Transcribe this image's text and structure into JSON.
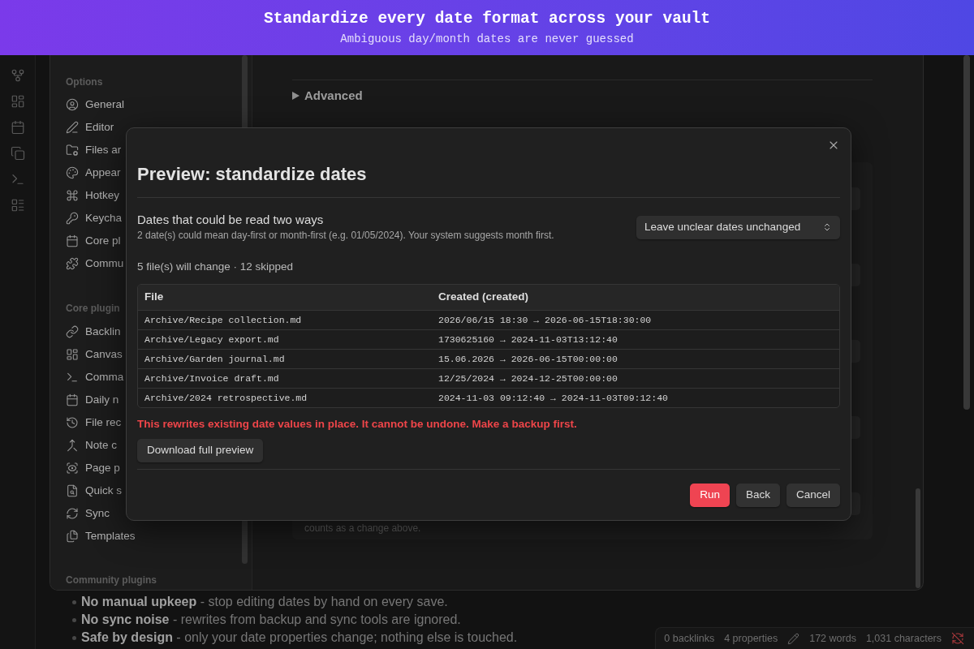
{
  "banner": {
    "title": "Standardize every date format across your vault",
    "subtitle": "Ambiguous day/month dates are never guessed"
  },
  "nav": {
    "options_heading": "Options",
    "options": [
      "General",
      "Editor",
      "Files ar",
      "Appear",
      "Hotkey",
      "Keycha",
      "Core pl",
      "Commu"
    ],
    "core_heading": "Core plugin",
    "core_plugins": [
      "Backlin",
      "Canvas",
      "Comma",
      "Daily n",
      "File rec",
      "Note c",
      "Page p",
      "Quick s",
      "Sync",
      "Templates"
    ],
    "community_heading": "Community plugins"
  },
  "panel": {
    "advanced": {
      "label": "Advanced",
      "expanded": false
    },
    "footnote": "counts as a change above."
  },
  "dialog": {
    "title": "Preview: standardize dates",
    "ambiguity": {
      "title": "Dates that could be read two ways",
      "description": "2 date(s) could mean day-first or month-first (e.g. 01/05/2024). Your system suggests month first.",
      "select": {
        "value": "Leave unclear dates unchanged"
      }
    },
    "summary": "5 file(s) will change · 12 skipped",
    "table": {
      "columns": [
        "File",
        "Created (created)"
      ],
      "rows": [
        [
          "Archive/Recipe collection.md",
          "2026/06/15 18:30 → 2026-06-15T18:30:00"
        ],
        [
          "Archive/Legacy export.md",
          "1730625160 → 2024-11-03T13:12:40"
        ],
        [
          "Archive/Garden journal.md",
          "15.06.2026 → 2026-06-15T00:00:00"
        ],
        [
          "Archive/Invoice draft.md",
          "12/25/2024 → 2024-12-25T00:00:00"
        ],
        [
          "Archive/2024 retrospective.md",
          "2024-11-03 09:12:40 → 2024-11-03T09:12:40"
        ]
      ]
    },
    "warning": "This rewrites existing date values in place. It cannot be undone. Make a backup first.",
    "download_button": "Download full preview",
    "buttons": [
      {
        "label": "Run",
        "kind": "primary"
      },
      {
        "label": "Back",
        "kind": "secondary"
      },
      {
        "label": "Cancel",
        "kind": "secondary"
      }
    ]
  },
  "note": {
    "bullets": [
      "**No manual upkeep** - stop editing dates by hand on every save.",
      "**No sync noise** - rewrites from backup and sync tools are ignored.",
      "**Safe by design** - only your date properties change; nothing else is touched."
    ]
  },
  "status_bar": {
    "items": [
      "0 backlinks",
      "4 properties",
      "172 words",
      "1,031 characters"
    ]
  }
}
